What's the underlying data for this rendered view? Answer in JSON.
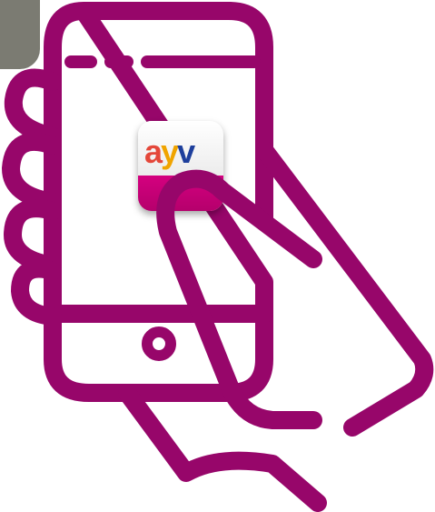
{
  "colors": {
    "stroke": "#97066a",
    "corner_tab": "#7b7b72",
    "icon_band": "#d4007f",
    "letter_a": "#e4473a",
    "letter_y": "#f0a400",
    "letter_v": "#1e3f9c",
    "background": "#ffffff"
  },
  "app_icon": {
    "wordmark": [
      "a",
      "y",
      "v"
    ]
  },
  "icons": {
    "corner": "corner-tab-icon",
    "phone": "smartphone-icon",
    "hand": "holding-hand-icon",
    "finger": "tapping-finger-icon",
    "home_button": "home-button-icon",
    "app": "app-logo-icon"
  }
}
